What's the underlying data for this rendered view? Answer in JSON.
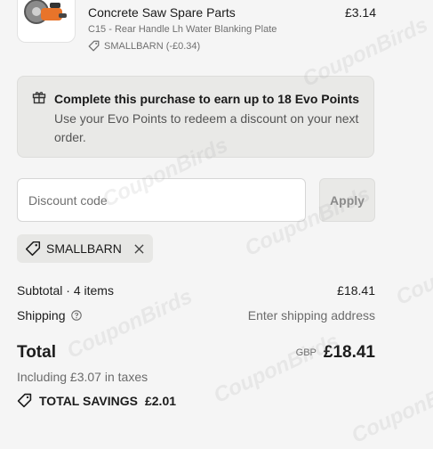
{
  "product": {
    "title": "Concrete Saw Spare Parts",
    "price": "£3.14",
    "variant": "C15 - Rear Handle Lh Water Blanking Plate",
    "discount": "SMALLBARN (-£0.34)",
    "image_icon": "concrete-saw-image",
    "discount_icon": "tag-icon"
  },
  "evo": {
    "icon": "gift-icon",
    "title": "Complete this purchase to earn up to 18 Evo Points",
    "body": "Use your Evo Points to redeem a discount on your next order."
  },
  "discount_form": {
    "placeholder": "Discount code",
    "apply_label": "Apply"
  },
  "applied_code": {
    "code": "SMALLBARN",
    "icon": "tag-icon",
    "remove_icon": "close-icon"
  },
  "summary": {
    "subtotal_label": "Subtotal · 4 items",
    "subtotal_value": "£18.41",
    "shipping_label": "Shipping",
    "shipping_help_icon": "help-circle-icon",
    "shipping_value": "Enter shipping address",
    "total_label": "Total",
    "currency": "GBP",
    "total_value": "£18.41",
    "taxes": "Including £3.07 in taxes",
    "savings_label": "TOTAL SAVINGS",
    "savings_value": "£2.01",
    "savings_icon": "tag-icon"
  },
  "watermark": "CouponBirds",
  "colors": {
    "background": "#f5f5f5",
    "panel": "#e9e9e7",
    "text": "#1c1c1c",
    "muted": "#6b6b6b"
  }
}
